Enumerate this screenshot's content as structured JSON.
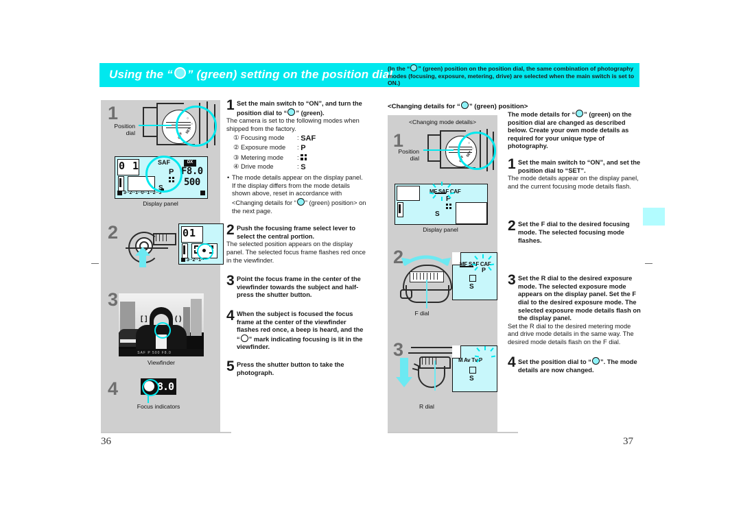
{
  "document": {
    "type": "camera-instruction-manual-spread",
    "left_page_number": "36",
    "right_page_number": "37"
  },
  "header": {
    "title_pre": "Using the “",
    "title_post": "” (green) setting on the position dial",
    "note": "(In the “",
    "note_rest": "” (green) position on the position dial, the same combination of photography modes (focusing, exposure, metering, drive) are selected when the main switch is set to ON.)",
    "bar_color": "#00e8ee",
    "title_color": "#ffffff"
  },
  "edge_tab": {
    "color": "#b2fcff"
  },
  "left_page": {
    "illustration": {
      "step1": {
        "number": "1",
        "position_dial_label_line1": "Position",
        "position_dial_label_line2": "dial",
        "dial_marks": [
          "○",
          "○",
          "SET",
          "OFF"
        ],
        "display_panel_caption": "Display panel",
        "lcd": {
          "frame_counter": "0 1",
          "focusing_mode": "SAF",
          "exposure_mode": "P",
          "metering_icon": "multi-segment-metering-icon",
          "drive_mode": "S",
          "dx_badge": "DX",
          "aperture": "F8.0",
          "shutter": "500",
          "exposure_scale": "3··2··1··0··1··2··3"
        }
      },
      "step2": {
        "number": "2",
        "lcd": {
          "frame_counter": "01",
          "focus_frame": "central-focus-frame",
          "exposure_scale": "3··2··1··"
        }
      },
      "step3": {
        "number": "3",
        "viewfinder_caption": "Viewfinder",
        "frame_left": "[ ]",
        "frame_right": "( )",
        "data_strip": "SAF  P  500  F8.0"
      },
      "step4": {
        "number": "4",
        "focus_indicator_caption": "Focus indicators",
        "indicator_circle": "in-focus-circle",
        "indicator_value": "8.0"
      }
    },
    "steps": [
      {
        "number": "1",
        "head": "Set the main switch to “ON”, and turn the position dial to “",
        "head_tail": "” (green).",
        "body": "The camera is set to the following modes when shipped from the factory.",
        "modes": [
          {
            "n": "①",
            "label": "Focusing mode",
            "sep": ":",
            "value": "SAF"
          },
          {
            "n": "②",
            "label": "Exposure mode",
            "sep": ":",
            "value": "P"
          },
          {
            "n": "③",
            "label": "Metering mode",
            "sep": ":",
            "value": "metering-icon"
          },
          {
            "n": "④",
            "label": "Drive mode",
            "sep": ":",
            "value": "S"
          }
        ],
        "bullet_pre": "The mode details appear on the display panel. If the display differs from the mode details shown above, reset in accordance with <Changing details for “",
        "bullet_post": "” (green) position> on the next page."
      },
      {
        "number": "2",
        "head": "Push the focusing frame select lever to select the central portion.",
        "body": "The selected position appears on the display panel. The selected focus frame flashes red once in the viewfinder."
      },
      {
        "number": "3",
        "head": "Point the focus frame in the center of the viewfinder towards the subject and half-press the shutter button.",
        "body": ""
      },
      {
        "number": "4",
        "head_pre": "When the subject is focused the focus frame at the center of the viewfinder flashes red once, a beep is heard, and the “",
        "head_post": "” mark indicating focusing is lit in the viewfinder.",
        "body": ""
      },
      {
        "number": "5",
        "head": "Press the shutter button to take the photograph.",
        "body": ""
      }
    ]
  },
  "right_page": {
    "section_heading_pre": "<Changing details for “",
    "section_heading_post": "” (green) position>",
    "illustration": {
      "heading": "<Changing mode details>",
      "step1": {
        "number": "1",
        "position_dial_label_line1": "Position",
        "position_dial_label_line2": "dial",
        "display_panel_caption": "Display panel",
        "lcd": {
          "focus_modes": "MF SAF CAF",
          "exposure_mode": "P",
          "metering_icon": "multi-segment-metering-icon",
          "drive_mode": "S",
          "flashing": "SAF"
        }
      },
      "step2": {
        "number": "2",
        "dial_caption": "F dial",
        "lcd": {
          "focus_modes": "MF SAF CAF",
          "exposure_mode": "P",
          "drive_mode": "S",
          "flashing": "CAF"
        }
      },
      "step3": {
        "number": "3",
        "dial_caption": "R dial",
        "lcd": {
          "exposure_modes": "M Av Tv P",
          "drive_mode": "S",
          "flashing": "P"
        }
      }
    },
    "intro_pre": "The mode details for “",
    "intro_post": "” (green) on the position dial are changed as described below. Create your own mode details as required for your unique type of photography.",
    "steps": [
      {
        "number": "1",
        "head": "Set the main switch to “ON”, and set the position dial to “SET”.",
        "body": "The mode details appear on the display panel, and the current focusing mode details flash."
      },
      {
        "number": "2",
        "head": "Set the F dial to the desired focusing mode. The selected focusing mode flashes.",
        "body": ""
      },
      {
        "number": "3",
        "head": "Set the R dial to the desired exposure mode. The selected exposure mode appears on the display panel. Set the F dial to the desired exposure mode. The selected exposure mode details flash on the display panel.",
        "body": "Set the R dial to the desired metering mode and drive mode details in the same way. The desired mode details flash on the F dial."
      },
      {
        "number": "4",
        "head_pre": "Set the position dial to “",
        "head_post": "”. The mode details are now changed."
      }
    ]
  }
}
